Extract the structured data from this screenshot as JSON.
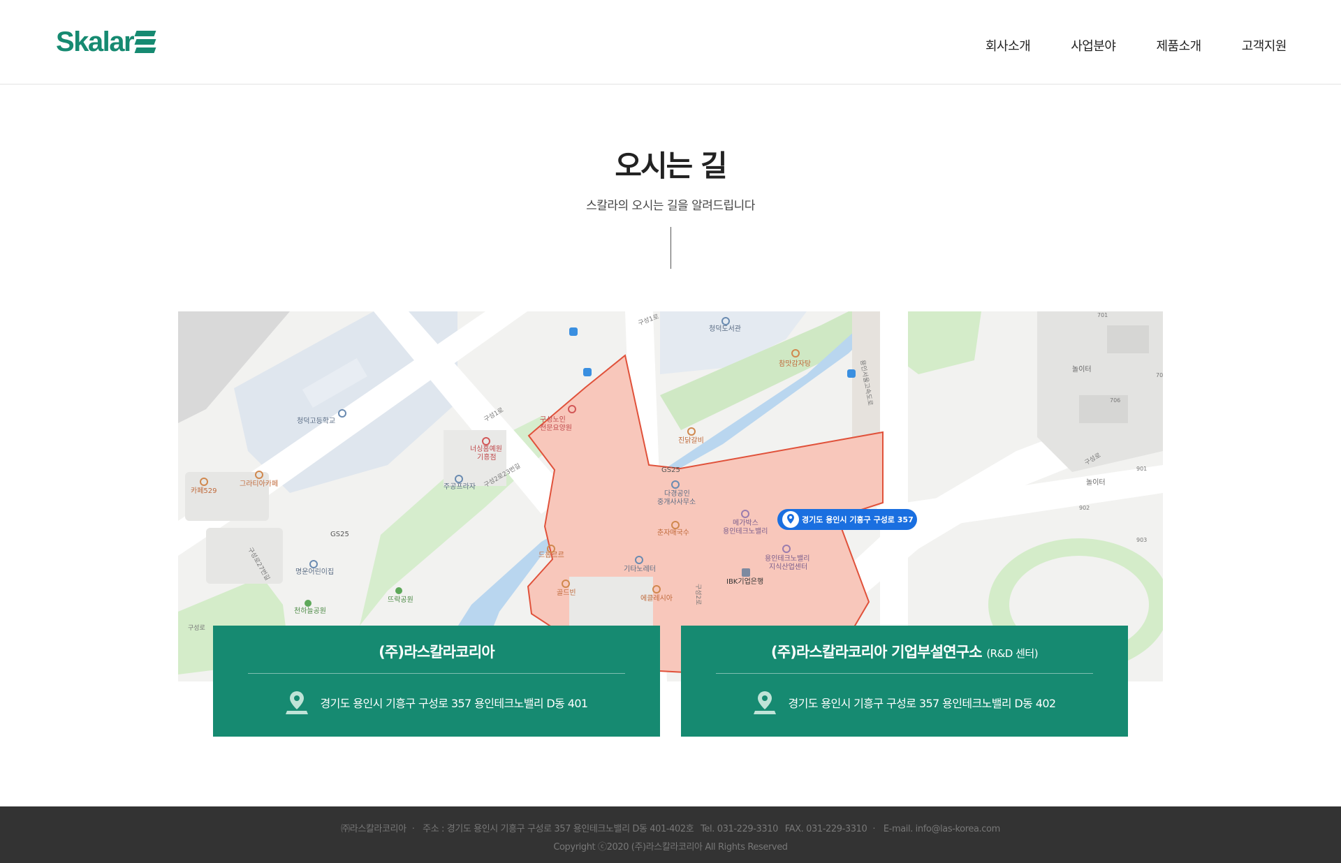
{
  "brand": {
    "logo_text": "Skalar",
    "color": "#168a71"
  },
  "nav": {
    "items": [
      {
        "label": "회사소개"
      },
      {
        "label": "사업분야"
      },
      {
        "label": "제품소개"
      },
      {
        "label": "고객지원"
      }
    ]
  },
  "page": {
    "title": "오시는 길",
    "subtitle": "스칼라의 오시는 길을 알려드립니다"
  },
  "map": {
    "callout": "경기도 용인시 기흥구 구성로 357",
    "labels": {
      "school": "청덕고등학교",
      "library": "청덕도서관",
      "restaurant1": "참맛감자탕",
      "hospital1": "구성노인",
      "hospital1b": "전문요양원",
      "hospital2": "너싱홈예원",
      "hospital2b": "기흥점",
      "plaza": "주공프라자",
      "cafe529": "카페529",
      "grazia": "그라티아카페",
      "gs25a": "GS25",
      "gs25b": "GS25",
      "jindak": "진닭갈비",
      "realtor1": "다경공인",
      "realtor2": "중개사사무소",
      "megabox1": "메가박스",
      "megabox2": "용인테크노밸리",
      "chuncheon": "춘자매국수",
      "drop": "드롭르르",
      "guitar": "기타노레터",
      "ibk": "IBK기업은행",
      "techno1": "용인테크노밸리",
      "techno2": "지식산업센터",
      "goldbin": "골드빈",
      "ecclesia": "에클레시아",
      "kinder": "명운어린이집",
      "park1": "뜨락공원",
      "park2": "천하늘공원",
      "playground1": "놀이터",
      "playground2": "놀이터",
      "road1": "구성1로",
      "road2": "구성1로",
      "road3": "구성2로23번길",
      "road4": "구성로",
      "road5": "구성로",
      "road6": "구성2로",
      "road7": "구성로27번길",
      "road8": "용인서울고속도로",
      "bldg701": "701",
      "bldg706": "706",
      "bldg70": "70",
      "bldg901": "901",
      "bldg902": "902",
      "bldg903": "903"
    }
  },
  "locations": [
    {
      "name": "(주)라스칼라코리아",
      "suffix": "",
      "address": "경기도 용인시 기흥구 구성로 357 용인테크노밸리 D동 401"
    },
    {
      "name": "(주)라스칼라코리아 기업부설연구소",
      "suffix": "(R&D 센터)",
      "address": "경기도 용인시 기흥구 구성로 357 용인테크노밸리 D동 402"
    }
  ],
  "footer": {
    "company": "㈜라스칼라코리아",
    "address": "주소 : 경기도 용인시 기흥구 구성로 357 용인테크노밸리 D동 401-402호",
    "tel": "Tel. 031-229-3310",
    "fax": "FAX. 031-229-3310",
    "email": "E-mail. info@las-korea.com",
    "copyright": "Copyright ⓒ2020 (주)라스칼라코리아 All Rights Reserved"
  }
}
